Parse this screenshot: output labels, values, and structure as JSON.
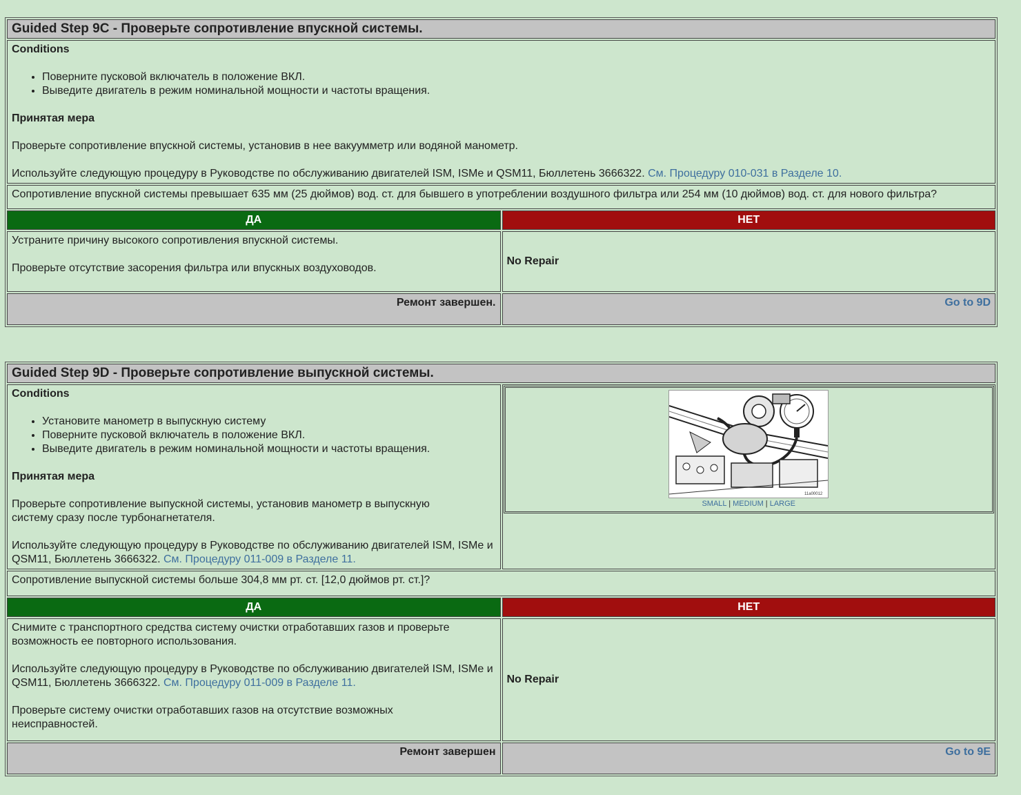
{
  "step9c": {
    "title": "Guided Step 9C - Проверьте сопротивление впускной системы.",
    "conditions_label": "Conditions",
    "conditions": [
      "Поверните пусковой включатель в положение ВКЛ.",
      "Выведите двигатель в режим номинальной мощности и частоты вращения."
    ],
    "action_label": "Принятая мера",
    "action_text": "Проверьте сопротивление впускной системы, установив в нее вакуумметр или водяной манометр.",
    "procedure_text": "Используйте следующую процедуру в Руководстве по обслуживанию двигателей ISM, ISMe и QSM11, Бюллетень 3666322.",
    "procedure_link": "См. Процедуру 010-031 в Разделе 10.",
    "question": "Сопротивление впускной системы превышает 635 мм (25 дюймов) вод. ст. для бывшего в употреблении воздушного фильтра или 254 мм (10 дюймов) вод. ст. для нового фильтра?",
    "yes_label": "ДА",
    "no_label": "НЕТ",
    "yes_text_1": "Устраните причину высокого сопротивления впускной системы.",
    "yes_text_2": "Проверьте отсутствие засорения фильтра или впускных воздуховодов.",
    "no_text": "No Repair",
    "yes_footer": "Ремонт завершен.",
    "no_footer_link": "Go to 9D"
  },
  "step9d": {
    "title": "Guided Step 9D - Проверьте сопротивление выпускной системы.",
    "conditions_label": "Conditions",
    "conditions": [
      "Установите манометр в выпускную систему",
      "Поверните пусковой включатель в положение ВКЛ.",
      "Выведите двигатель в режим номинальной мощности и частоты вращения."
    ],
    "action_label": "Принятая мера",
    "action_text": "Проверьте сопротивление выпускной системы, установив манометр в выпускную систему сразу после турбонагнетателя.",
    "procedure_text": "Используйте следующую процедуру в Руководстве по обслуживанию двигателей ISM, ISMe и QSM11, Бюллетень 3666322.",
    "procedure_link": "См. Процедуру 011-009 в Разделе 11.",
    "image_id": "11a00012",
    "size_links": {
      "small": "SMALL",
      "medium": "MEDIUM",
      "large": "LARGE"
    },
    "question": "Сопротивление выпускной системы больше 304,8 мм рт. ст. [12,0 дюймов рт. ст.]?",
    "yes_label": "ДА",
    "no_label": "НЕТ",
    "yes_text_1": "Снимите с транспортного средства систему очистки отработавших газов и проверьте возможность ее повторного использования.",
    "yes_text_2": "Используйте следующую процедуру в Руководстве по обслуживанию двигателей ISM, ISMe и QSM11, Бюллетень 3666322.",
    "yes_text_2_link": "См. Процедуру 011-009 в Разделе 11.",
    "yes_text_3": "Проверьте систему очистки отработавших газов на отсутствие возможных неисправностей.",
    "no_text": "No Repair",
    "yes_footer": "Ремонт завершен",
    "no_footer_link": "Go to 9E"
  }
}
